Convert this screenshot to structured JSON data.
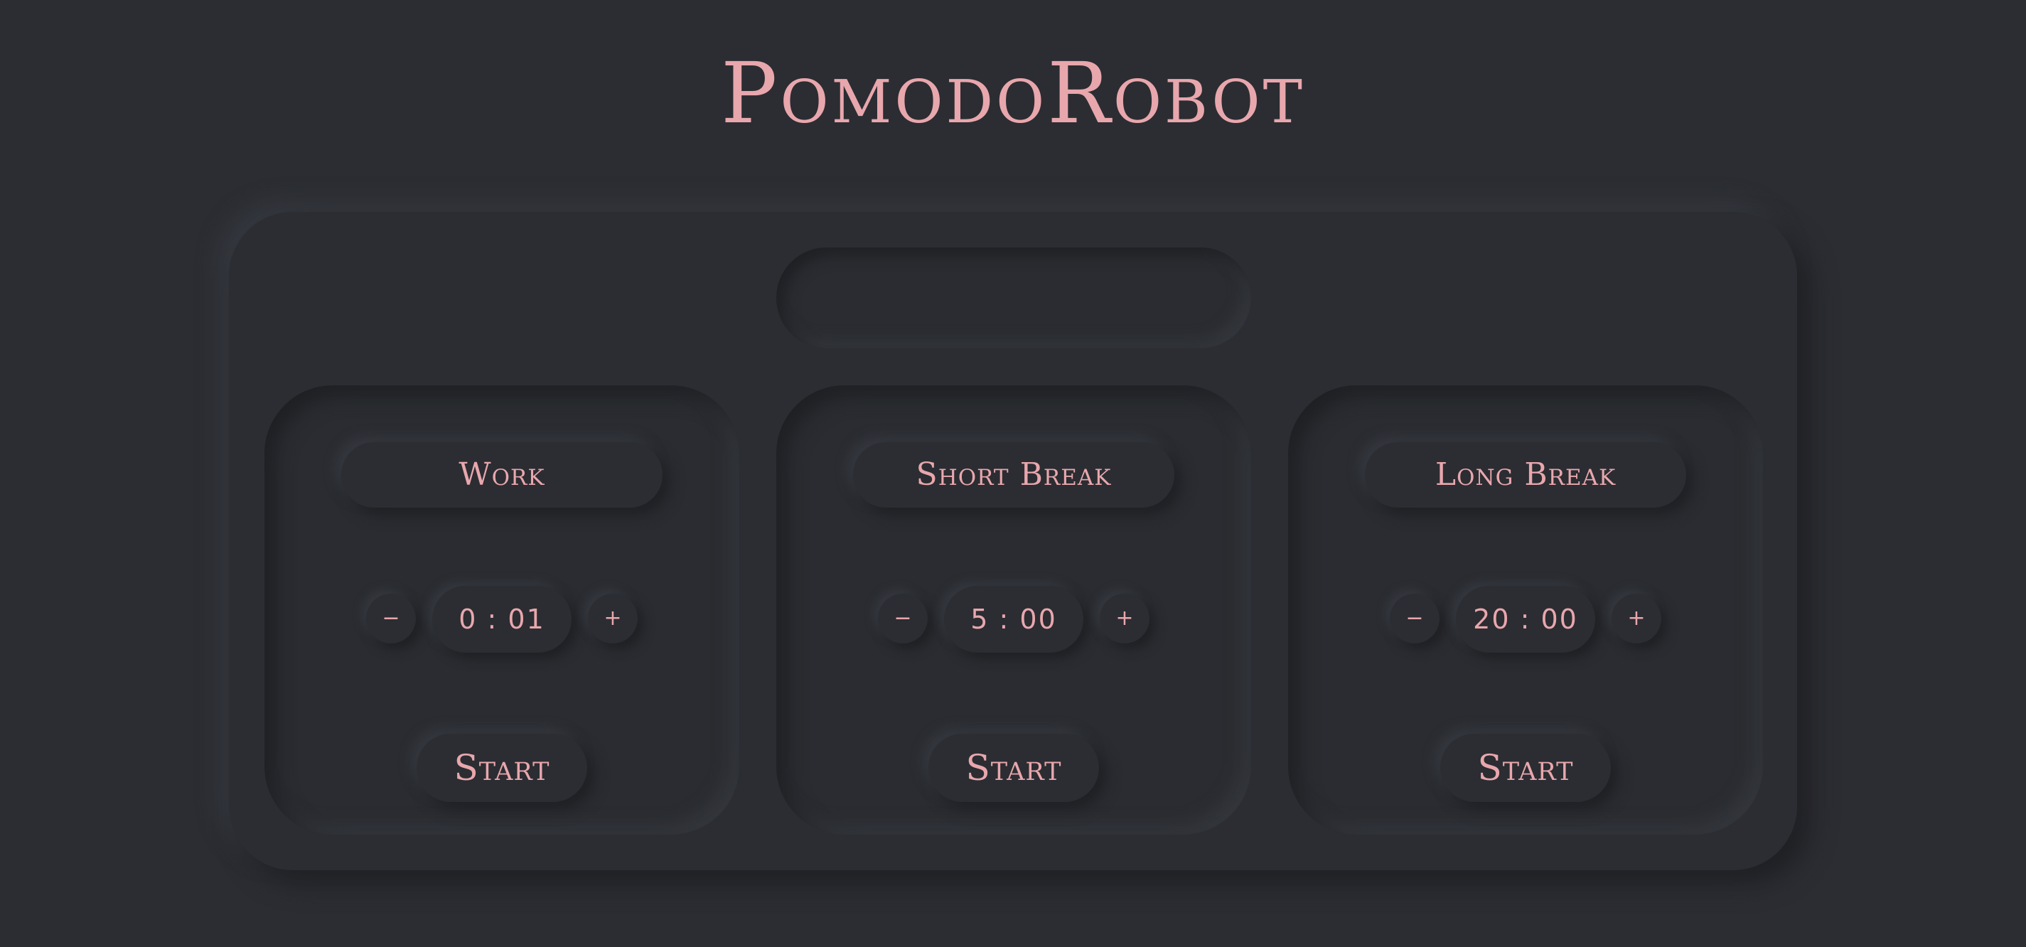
{
  "app": {
    "title": "PomodoRobot"
  },
  "status": {
    "text": ""
  },
  "timers": [
    {
      "label": "Work",
      "time": "0 : 01",
      "decrement": "−",
      "increment": "+",
      "start_label": "Start"
    },
    {
      "label": "Short Break",
      "time": "5 : 00",
      "decrement": "−",
      "increment": "+",
      "start_label": "Start"
    },
    {
      "label": "Long Break",
      "time": "20 : 00",
      "decrement": "−",
      "increment": "+",
      "start_label": "Start"
    }
  ],
  "colors": {
    "background": "#2b2d32",
    "accent": "#e8a7ad"
  }
}
